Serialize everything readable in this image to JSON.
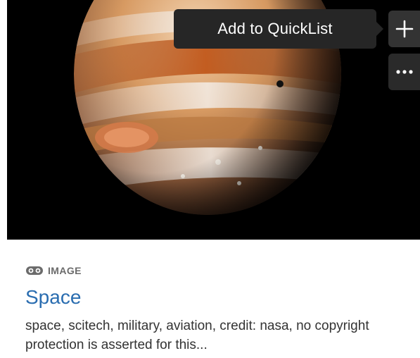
{
  "tooltip": {
    "text": "Add to QuickList"
  },
  "actions": {
    "add_icon": "plus-icon",
    "more_icon": "ellipsis-icon"
  },
  "item": {
    "type_icon": "image-glasses-icon",
    "type_label": "IMAGE",
    "title": "Space",
    "description": "space, scitech, military, aviation, credit: nasa, no copyright protection is asserted for this..."
  },
  "colors": {
    "title_link": "#2a6db0",
    "type_label": "#6b6b6b",
    "tooltip_bg": "#262626",
    "button_bg": "#333333",
    "text": "#333333"
  }
}
